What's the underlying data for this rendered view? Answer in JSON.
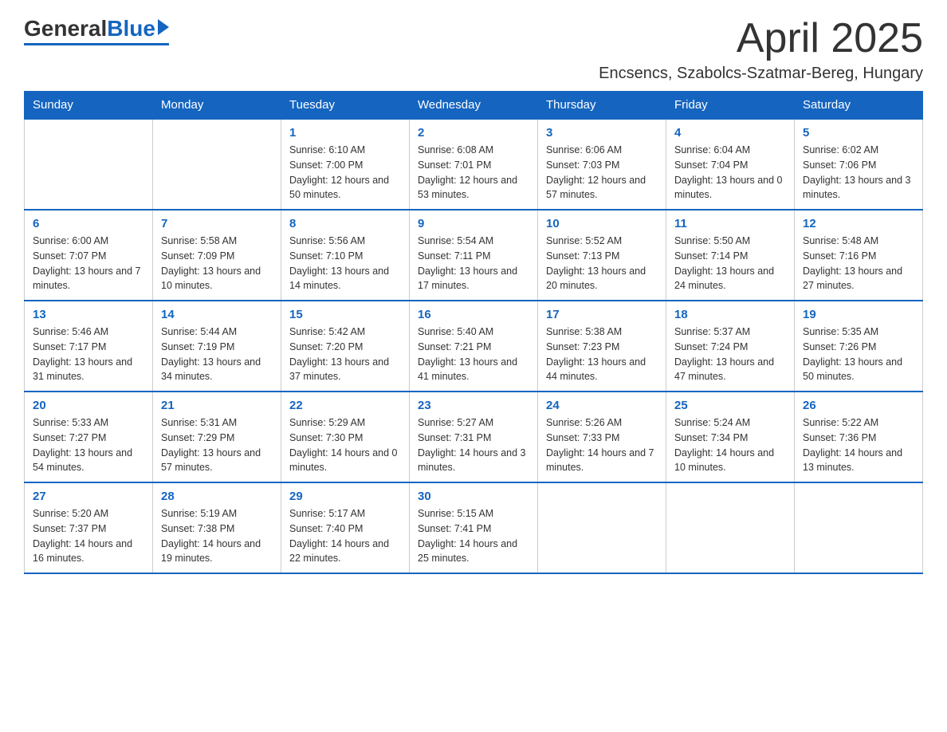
{
  "logo": {
    "general": "General",
    "blue": "Blue"
  },
  "header": {
    "title": "April 2025",
    "subtitle": "Encsencs, Szabolcs-Szatmar-Bereg, Hungary"
  },
  "days_of_week": [
    "Sunday",
    "Monday",
    "Tuesday",
    "Wednesday",
    "Thursday",
    "Friday",
    "Saturday"
  ],
  "weeks": [
    [
      {
        "day": "",
        "info": ""
      },
      {
        "day": "",
        "info": ""
      },
      {
        "day": "1",
        "info": "Sunrise: 6:10 AM\nSunset: 7:00 PM\nDaylight: 12 hours\nand 50 minutes."
      },
      {
        "day": "2",
        "info": "Sunrise: 6:08 AM\nSunset: 7:01 PM\nDaylight: 12 hours\nand 53 minutes."
      },
      {
        "day": "3",
        "info": "Sunrise: 6:06 AM\nSunset: 7:03 PM\nDaylight: 12 hours\nand 57 minutes."
      },
      {
        "day": "4",
        "info": "Sunrise: 6:04 AM\nSunset: 7:04 PM\nDaylight: 13 hours\nand 0 minutes."
      },
      {
        "day": "5",
        "info": "Sunrise: 6:02 AM\nSunset: 7:06 PM\nDaylight: 13 hours\nand 3 minutes."
      }
    ],
    [
      {
        "day": "6",
        "info": "Sunrise: 6:00 AM\nSunset: 7:07 PM\nDaylight: 13 hours\nand 7 minutes."
      },
      {
        "day": "7",
        "info": "Sunrise: 5:58 AM\nSunset: 7:09 PM\nDaylight: 13 hours\nand 10 minutes."
      },
      {
        "day": "8",
        "info": "Sunrise: 5:56 AM\nSunset: 7:10 PM\nDaylight: 13 hours\nand 14 minutes."
      },
      {
        "day": "9",
        "info": "Sunrise: 5:54 AM\nSunset: 7:11 PM\nDaylight: 13 hours\nand 17 minutes."
      },
      {
        "day": "10",
        "info": "Sunrise: 5:52 AM\nSunset: 7:13 PM\nDaylight: 13 hours\nand 20 minutes."
      },
      {
        "day": "11",
        "info": "Sunrise: 5:50 AM\nSunset: 7:14 PM\nDaylight: 13 hours\nand 24 minutes."
      },
      {
        "day": "12",
        "info": "Sunrise: 5:48 AM\nSunset: 7:16 PM\nDaylight: 13 hours\nand 27 minutes."
      }
    ],
    [
      {
        "day": "13",
        "info": "Sunrise: 5:46 AM\nSunset: 7:17 PM\nDaylight: 13 hours\nand 31 minutes."
      },
      {
        "day": "14",
        "info": "Sunrise: 5:44 AM\nSunset: 7:19 PM\nDaylight: 13 hours\nand 34 minutes."
      },
      {
        "day": "15",
        "info": "Sunrise: 5:42 AM\nSunset: 7:20 PM\nDaylight: 13 hours\nand 37 minutes."
      },
      {
        "day": "16",
        "info": "Sunrise: 5:40 AM\nSunset: 7:21 PM\nDaylight: 13 hours\nand 41 minutes."
      },
      {
        "day": "17",
        "info": "Sunrise: 5:38 AM\nSunset: 7:23 PM\nDaylight: 13 hours\nand 44 minutes."
      },
      {
        "day": "18",
        "info": "Sunrise: 5:37 AM\nSunset: 7:24 PM\nDaylight: 13 hours\nand 47 minutes."
      },
      {
        "day": "19",
        "info": "Sunrise: 5:35 AM\nSunset: 7:26 PM\nDaylight: 13 hours\nand 50 minutes."
      }
    ],
    [
      {
        "day": "20",
        "info": "Sunrise: 5:33 AM\nSunset: 7:27 PM\nDaylight: 13 hours\nand 54 minutes."
      },
      {
        "day": "21",
        "info": "Sunrise: 5:31 AM\nSunset: 7:29 PM\nDaylight: 13 hours\nand 57 minutes."
      },
      {
        "day": "22",
        "info": "Sunrise: 5:29 AM\nSunset: 7:30 PM\nDaylight: 14 hours\nand 0 minutes."
      },
      {
        "day": "23",
        "info": "Sunrise: 5:27 AM\nSunset: 7:31 PM\nDaylight: 14 hours\nand 3 minutes."
      },
      {
        "day": "24",
        "info": "Sunrise: 5:26 AM\nSunset: 7:33 PM\nDaylight: 14 hours\nand 7 minutes."
      },
      {
        "day": "25",
        "info": "Sunrise: 5:24 AM\nSunset: 7:34 PM\nDaylight: 14 hours\nand 10 minutes."
      },
      {
        "day": "26",
        "info": "Sunrise: 5:22 AM\nSunset: 7:36 PM\nDaylight: 14 hours\nand 13 minutes."
      }
    ],
    [
      {
        "day": "27",
        "info": "Sunrise: 5:20 AM\nSunset: 7:37 PM\nDaylight: 14 hours\nand 16 minutes."
      },
      {
        "day": "28",
        "info": "Sunrise: 5:19 AM\nSunset: 7:38 PM\nDaylight: 14 hours\nand 19 minutes."
      },
      {
        "day": "29",
        "info": "Sunrise: 5:17 AM\nSunset: 7:40 PM\nDaylight: 14 hours\nand 22 minutes."
      },
      {
        "day": "30",
        "info": "Sunrise: 5:15 AM\nSunset: 7:41 PM\nDaylight: 14 hours\nand 25 minutes."
      },
      {
        "day": "",
        "info": ""
      },
      {
        "day": "",
        "info": ""
      },
      {
        "day": "",
        "info": ""
      }
    ]
  ]
}
